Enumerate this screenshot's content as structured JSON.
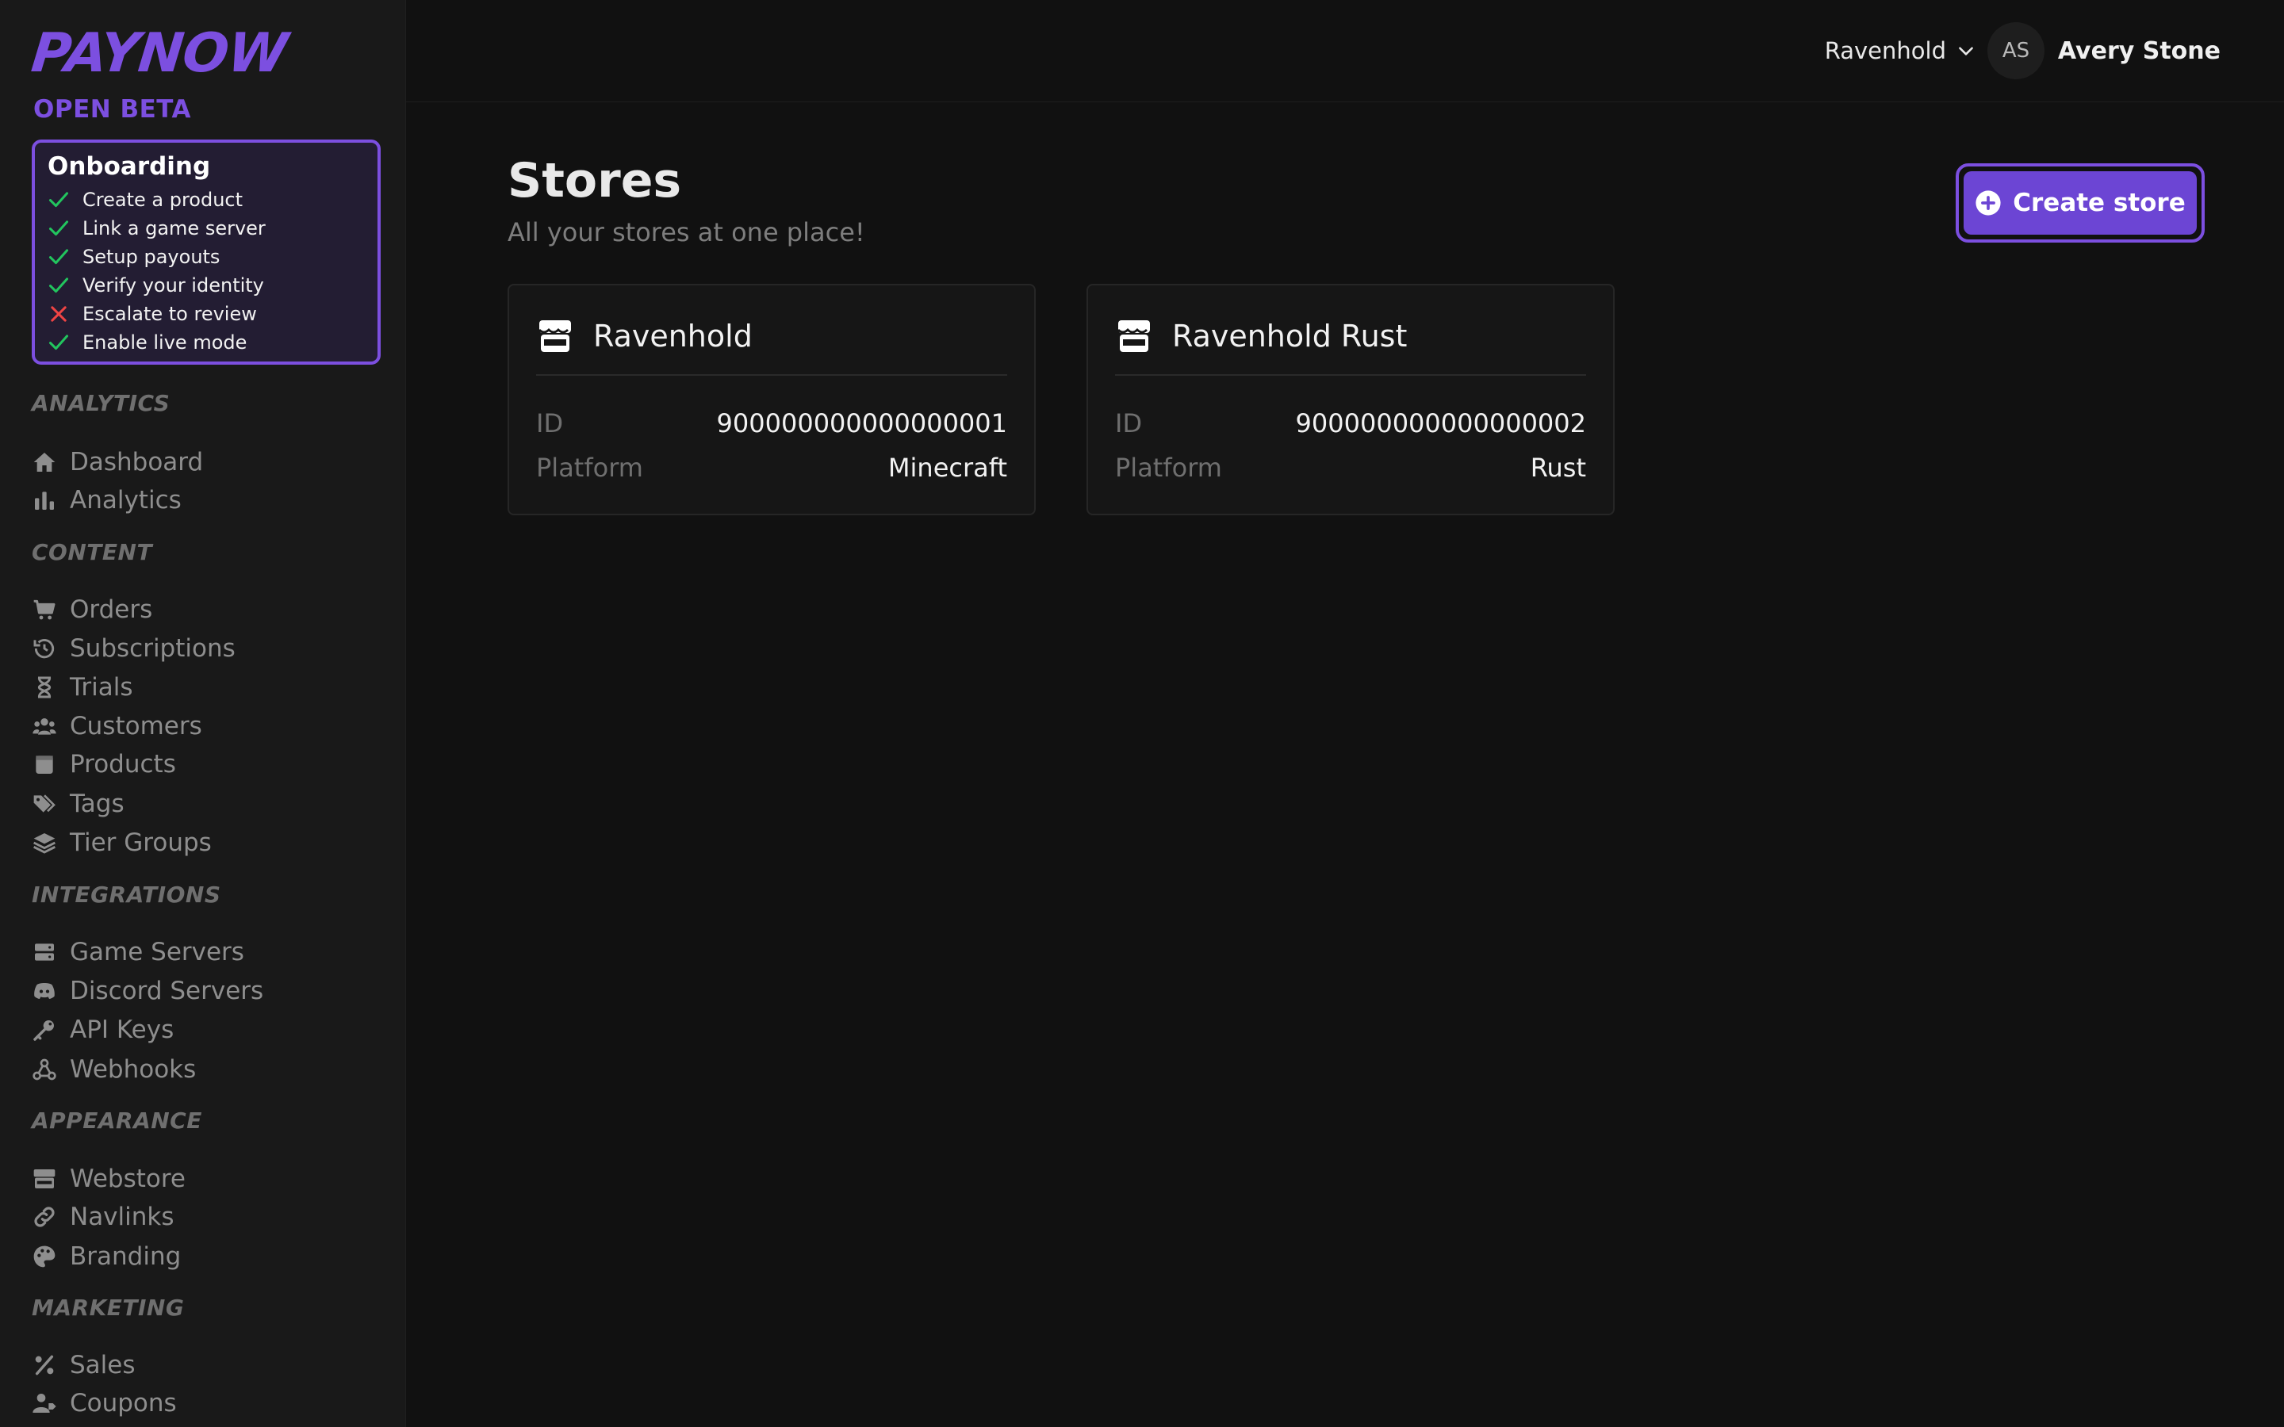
{
  "brand": {
    "name": "PAYNOW",
    "tag": "OPEN BETA",
    "accent": "#7c4fe0"
  },
  "onboarding": {
    "title": "Onboarding",
    "items": [
      {
        "label": "Create a product",
        "done": true
      },
      {
        "label": "Link a game server",
        "done": true
      },
      {
        "label": "Setup payouts",
        "done": true
      },
      {
        "label": "Verify your identity",
        "done": true
      },
      {
        "label": "Escalate to review",
        "done": false
      },
      {
        "label": "Enable live mode",
        "done": true
      }
    ]
  },
  "sidebar": {
    "analytics": {
      "title": "ANALYTICS",
      "items": [
        {
          "label": "Dashboard",
          "icon": "home-icon"
        },
        {
          "label": "Analytics",
          "icon": "bar-chart-icon"
        }
      ]
    },
    "content": {
      "title": "CONTENT",
      "items": [
        {
          "label": "Orders",
          "icon": "cart-icon"
        },
        {
          "label": "Subscriptions",
          "icon": "history-icon"
        },
        {
          "label": "Trials",
          "icon": "hourglass-icon"
        },
        {
          "label": "Customers",
          "icon": "users-icon"
        },
        {
          "label": "Products",
          "icon": "box-icon"
        },
        {
          "label": "Tags",
          "icon": "tags-icon"
        },
        {
          "label": "Tier Groups",
          "icon": "layers-icon"
        }
      ]
    },
    "integrations": {
      "title": "INTEGRATIONS",
      "items": [
        {
          "label": "Game Servers",
          "icon": "server-icon"
        },
        {
          "label": "Discord Servers",
          "icon": "discord-icon"
        },
        {
          "label": "API Keys",
          "icon": "key-icon"
        },
        {
          "label": "Webhooks",
          "icon": "webhook-icon"
        }
      ]
    },
    "appearance": {
      "title": "APPEARANCE",
      "items": [
        {
          "label": "Webstore",
          "icon": "store-icon"
        },
        {
          "label": "Navlinks",
          "icon": "link-icon"
        },
        {
          "label": "Branding",
          "icon": "palette-icon"
        }
      ]
    },
    "marketing": {
      "title": "MARKETING",
      "items": [
        {
          "label": "Sales",
          "icon": "percent-icon"
        },
        {
          "label": "Coupons",
          "icon": "user-tag-icon"
        }
      ]
    }
  },
  "header": {
    "store_selector": "Ravenhold",
    "user_initials": "AS",
    "user_name": "Avery Stone"
  },
  "main": {
    "title": "Stores",
    "subtitle": "All your stores at one place!",
    "create_button": "Create store",
    "stores": [
      {
        "name": "Ravenhold",
        "id_label": "ID",
        "id": "900000000000000001",
        "platform_label": "Platform",
        "platform": "Minecraft"
      },
      {
        "name": "Ravenhold Rust",
        "id_label": "ID",
        "id": "900000000000000002",
        "platform_label": "Platform",
        "platform": "Rust"
      }
    ]
  }
}
